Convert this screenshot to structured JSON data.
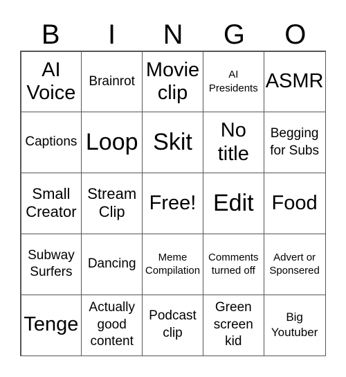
{
  "header": {
    "letters": [
      "B",
      "I",
      "N",
      "G",
      "O"
    ]
  },
  "rows": [
    [
      "AI Voice",
      "Brainrot",
      "Movie clip",
      "AI Presidents",
      "ASMR"
    ],
    [
      "Captions",
      "Loop",
      "Skit",
      "No title",
      "Begging for Subs"
    ],
    [
      "Small Creator",
      "Stream Clip",
      "Free!",
      "Edit",
      "Food"
    ],
    [
      "Subway Surfers",
      "Dancing",
      "Meme Compilation",
      "Comments turned off",
      "Advert or Sponsered"
    ],
    [
      "Tenge",
      "Actually good content",
      "Podcast clip",
      "Green screen kid",
      "Big Youtuber"
    ]
  ]
}
